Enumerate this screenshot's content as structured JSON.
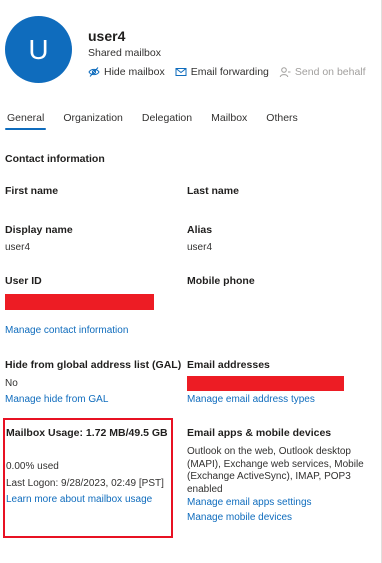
{
  "header": {
    "avatar_initial": "U",
    "name": "user4",
    "mailbox_type": "Shared mailbox",
    "actions": [
      {
        "label": "Hide mailbox",
        "icon": "hide-icon"
      },
      {
        "label": "Email forwarding",
        "icon": "mail-icon"
      },
      {
        "label": "Send on behalf",
        "icon": "person-icon"
      }
    ]
  },
  "tabs": [
    {
      "label": "General",
      "active": true
    },
    {
      "label": "Organization"
    },
    {
      "label": "Delegation"
    },
    {
      "label": "Mailbox"
    },
    {
      "label": "Others"
    }
  ],
  "contact": {
    "section_title": "Contact information",
    "first_name_label": "First name",
    "last_name_label": "Last name",
    "display_name_label": "Display name",
    "display_name_value": "user4",
    "alias_label": "Alias",
    "alias_value": "user4",
    "user_id_label": "User ID",
    "mobile_phone_label": "Mobile phone",
    "manage_link": "Manage contact information"
  },
  "gal": {
    "label": "Hide from global address list (GAL)",
    "value": "No",
    "link": "Manage hide from GAL"
  },
  "email_addresses": {
    "label": "Email addresses",
    "link": "Manage email address types"
  },
  "mailbox_usage": {
    "label": "Mailbox Usage: 1.72 MB/49.5 GB",
    "used": "0.00% used",
    "last_logon": "Last Logon: 9/28/2023, 02:49 [PST]",
    "link": "Learn more about mailbox usage"
  },
  "email_apps": {
    "label": "Email apps & mobile devices",
    "description": "Outlook on the web, Outlook desktop (MAPI), Exchange web services, Mobile (Exchange ActiveSync), IMAP, POP3 enabled",
    "link_settings": "Manage email apps settings",
    "link_devices": "Manage mobile devices"
  },
  "colors": {
    "accent": "#0f6cbd",
    "redaction": "#ed1c24",
    "highlight_border": "#e81123"
  }
}
